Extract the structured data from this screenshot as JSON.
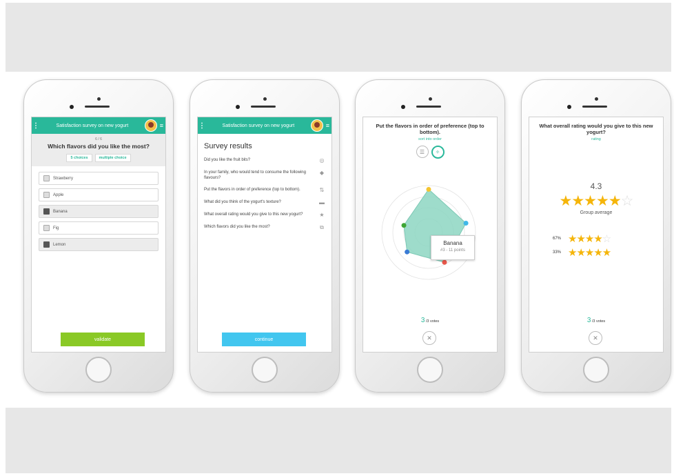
{
  "colors": {
    "primary": "#29b89a",
    "validate": "#8ac926",
    "continue": "#42c6ef",
    "star": "#f5b50a"
  },
  "screen1": {
    "app_title": "Satisfaction survey on new yogurt",
    "progress": "6 / 6",
    "question": "Which flavors did you like the most?",
    "tags": [
      "5 choices",
      "multiple choice"
    ],
    "choices": [
      {
        "label": "Strawberry",
        "selected": false
      },
      {
        "label": "Apple",
        "selected": false
      },
      {
        "label": "Banana",
        "selected": true
      },
      {
        "label": "Fig",
        "selected": false
      },
      {
        "label": "Lemon",
        "selected": true
      }
    ],
    "validate_label": "validate"
  },
  "screen2": {
    "app_title": "Satisfaction survey on new yogurt",
    "title": "Survey results",
    "items": [
      {
        "text": "Did you like the fruit bits?",
        "icon": "check-circle-icon"
      },
      {
        "text": "In your family, who would tend to consume the following flavours?",
        "icon": "tag-icon"
      },
      {
        "text": "Put the flavors in order of preference (top to bottom).",
        "icon": "sort-icon"
      },
      {
        "text": "What did you think of the yogurt's texture?",
        "icon": "comment-icon"
      },
      {
        "text": "What overall rating would you give to this new yogurt?",
        "icon": "star-icon"
      },
      {
        "text": "Which flavors did you like the most?",
        "icon": "multiple-choice-icon"
      }
    ],
    "continue_label": "continue"
  },
  "screen3": {
    "question": "Put the flavors in order of preference (top to bottom).",
    "subtitle": "sort into order",
    "tooltip_name": "Banana",
    "tooltip_points": "#3 - 11 points",
    "votes_count": "3",
    "votes_text": "/3 votes",
    "radar_values": [
      0.92,
      0.82,
      0.72,
      0.62,
      0.55
    ]
  },
  "screen4": {
    "question": "What overall rating would you give to this new yogurt?",
    "subtitle": "rating",
    "score": "4.3",
    "group_label": "Group average",
    "distribution": [
      {
        "pct": "67%",
        "stars": 4
      },
      {
        "pct": "33%",
        "stars": 5
      }
    ],
    "votes_count": "3",
    "votes_text": "/3 votes"
  }
}
